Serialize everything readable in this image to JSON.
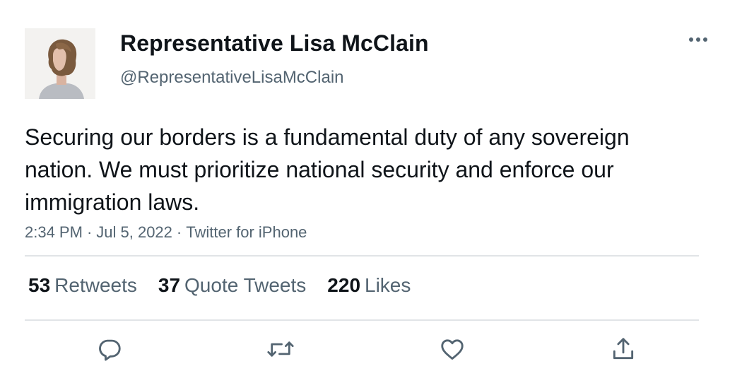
{
  "author": {
    "display_name": "Representative Lisa McClain",
    "handle": "@RepresentativeLisaMcClain"
  },
  "tweet": {
    "text": "Securing our borders is a fundamental duty of any sovereign nation. We must prioritize national security and enforce our immigration laws.",
    "time": "2:34 PM",
    "date": "Jul 5, 2022",
    "source": "Twitter for iPhone",
    "separator": "·"
  },
  "stats": {
    "retweets": {
      "count": "53",
      "label": "Retweets"
    },
    "quote_tweets": {
      "count": "37",
      "label": "Quote Tweets"
    },
    "likes": {
      "count": "220",
      "label": "Likes"
    }
  },
  "icons": {
    "more": "more-horizontal-icon",
    "reply": "reply-icon",
    "retweet": "retweet-icon",
    "like": "heart-icon",
    "share": "share-icon"
  },
  "colors": {
    "text_primary": "#0f1419",
    "text_secondary": "#536471",
    "divider": "#e1e4e7",
    "icon": "#536471"
  }
}
